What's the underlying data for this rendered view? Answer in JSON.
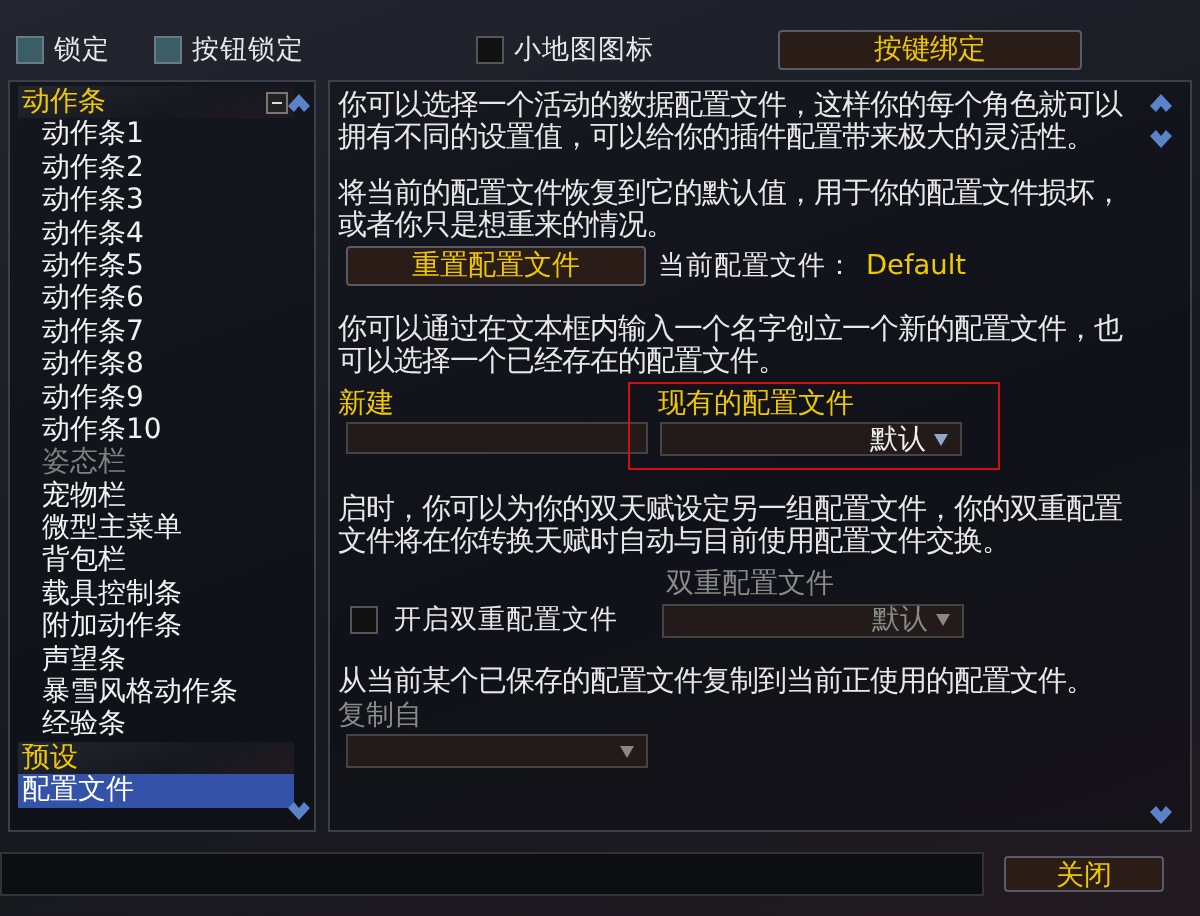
{
  "top_bar": {
    "checkboxes": [
      {
        "label": "锁定",
        "checked": true
      },
      {
        "label": "按钮锁定",
        "checked": true
      },
      {
        "label": "小地图图标",
        "checked": false
      }
    ],
    "button": "按键绑定"
  },
  "sidebar": {
    "items": [
      {
        "label": "动作条",
        "selected": false,
        "disabled": false,
        "expanded": true,
        "children": [
          {
            "label": "动作条1",
            "selected": false,
            "disabled": false
          },
          {
            "label": "动作条2",
            "selected": false,
            "disabled": false
          },
          {
            "label": "动作条3",
            "selected": false,
            "disabled": false
          },
          {
            "label": "动作条4",
            "selected": false,
            "disabled": false
          },
          {
            "label": "动作条5",
            "selected": false,
            "disabled": false
          },
          {
            "label": "动作条6",
            "selected": false,
            "disabled": false
          },
          {
            "label": "动作条7",
            "selected": false,
            "disabled": false
          },
          {
            "label": "动作条8",
            "selected": false,
            "disabled": false
          },
          {
            "label": "动作条9",
            "selected": false,
            "disabled": false
          },
          {
            "label": "动作条10",
            "selected": false,
            "disabled": false
          },
          {
            "label": "姿态栏",
            "selected": false,
            "disabled": true
          },
          {
            "label": "宠物栏",
            "selected": false,
            "disabled": false
          },
          {
            "label": "微型主菜单",
            "selected": false,
            "disabled": false
          },
          {
            "label": "背包栏",
            "selected": false,
            "disabled": false
          },
          {
            "label": "载具控制条",
            "selected": false,
            "disabled": false
          },
          {
            "label": "附加动作条",
            "selected": false,
            "disabled": false
          },
          {
            "label": "声望条",
            "selected": false,
            "disabled": false
          },
          {
            "label": "暴雪风格动作条",
            "selected": false,
            "disabled": false
          },
          {
            "label": "经验条",
            "selected": false,
            "disabled": false
          }
        ]
      },
      {
        "label": "预设",
        "selected": false,
        "disabled": false
      },
      {
        "label": "配置文件",
        "selected": true,
        "disabled": false
      }
    ]
  },
  "profiles": {
    "intro": "你可以选择一个活动的数据配置文件，这样你的每个角色就可以拥有不同的设置值，可以给你的插件配置带来极大的灵活性。",
    "reset_text": "将当前的配置文件恢复到它的默认值，用于你的配置文件损坏，或者你只是想重来的情况。",
    "reset_button": "重置配置文件",
    "current_label": "当前配置文件：",
    "current_value": "Default",
    "new_text": "你可以通过在文本框内输入一个名字创立一个新的配置文件，也可以选择一个已经存在的配置文件。",
    "new_label": "新建",
    "existing": {
      "label": "现有的配置文件",
      "value": "默认",
      "disabled": false,
      "highlighted": true
    },
    "dual_text": "启时，你可以为你的双天赋设定另一组配置文件，你的双重配置文件将在你转换天赋时自动与目前使用配置文件交换。",
    "dual": {
      "label": "双重配置文件",
      "value": "默认",
      "disabled": true
    },
    "dual_checkbox": {
      "label": "开启双重配置文件",
      "checked": false
    },
    "copy_text": "从当前某个已保存的配置文件复制到当前正使用的配置文件。",
    "copy_from": {
      "label": "复制自",
      "disabled": true
    }
  },
  "footer": {
    "close_button": "关闭"
  }
}
